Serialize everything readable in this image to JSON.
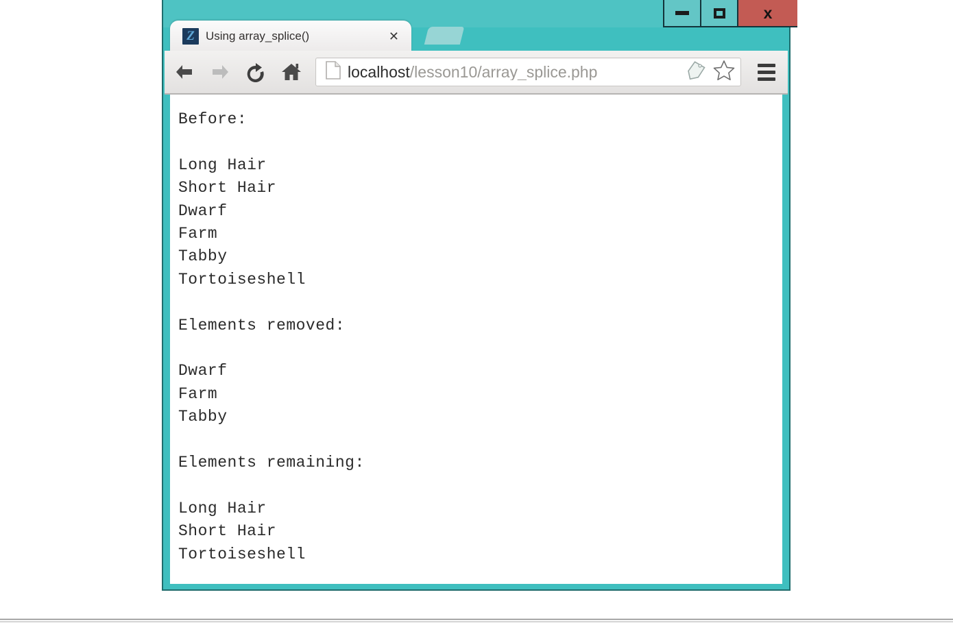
{
  "window": {
    "controls": {
      "minimize_label": "–",
      "maximize_label": "□",
      "close_label": "x"
    },
    "frame_color": "#3fbfbf",
    "close_color": "#c35b54"
  },
  "tab": {
    "title": "Using array_splice()",
    "close_label": "✕",
    "favicon_letter": "Z",
    "favicon_bg": "#1b3a5c"
  },
  "toolbar": {
    "back_icon": "arrow-left-icon",
    "forward_icon": "arrow-right-icon",
    "reload_icon": "reload-icon",
    "home_icon": "home-icon",
    "url_prefix": "localhost",
    "url_suffix": "/lesson10/array_splice.php",
    "url_full": "localhost/lesson10/array_splice.php",
    "tag_icon": "tag-icon",
    "star_icon": "star-icon",
    "menu_icon": "hamburger-menu-icon"
  },
  "page": {
    "body_text": "Before:\n\nLong Hair\nShort Hair\nDwarf\nFarm\nTabby\nTortoiseshell\n\nElements removed:\n\nDwarf\nFarm\nTabby\n\nElements remaining:\n\nLong Hair\nShort Hair\nTortoiseshell",
    "sections": [
      {
        "heading": "Before:",
        "items": [
          "Long Hair",
          "Short Hair",
          "Dwarf",
          "Farm",
          "Tabby",
          "Tortoiseshell"
        ]
      },
      {
        "heading": "Elements removed:",
        "items": [
          "Dwarf",
          "Farm",
          "Tabby"
        ]
      },
      {
        "heading": "Elements remaining:",
        "items": [
          "Long Hair",
          "Short Hair",
          "Tortoiseshell"
        ]
      }
    ]
  }
}
